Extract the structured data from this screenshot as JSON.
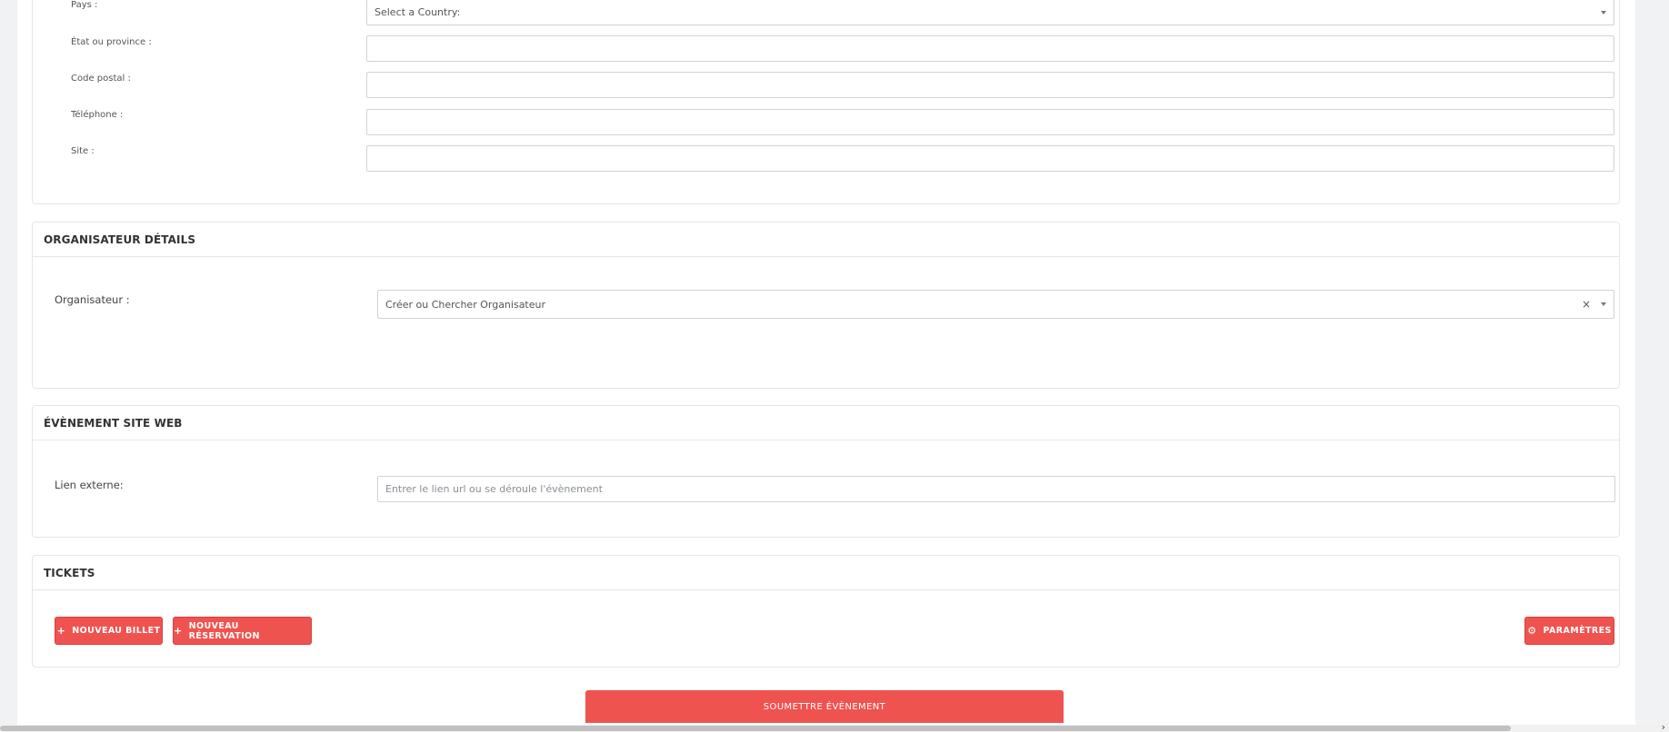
{
  "address_section": {
    "country_label": "Pays :",
    "country_value": "Select a Country:",
    "state_label": "État ou province :",
    "postal_label": "Code postal :",
    "phone_label": "Téléphone :",
    "site_label": "Site :"
  },
  "organizer_section": {
    "title": "ORGANISATEUR DÉTAILS",
    "organizer_label": "Organisateur :",
    "organizer_value": "Créer ou Chercher Organisateur",
    "clear_symbol": "×"
  },
  "website_section": {
    "title": "ÉVÈNEMENT SITE WEB",
    "link_label": "Lien externe:",
    "link_placeholder": "Entrer le lien url ou se déroule l'évènement"
  },
  "tickets_section": {
    "title": "TICKETS",
    "new_ticket_label": "NOUVEAU BILLET",
    "new_reservation_label": "NOUVEAU RÉSERVATION",
    "settings_label": "PARAMÈTRES"
  },
  "submit_label": "SOUMETTRE ÉVÈNEMENT",
  "icons": {
    "plus": "plus-icon",
    "gear": "gear-icon",
    "chevron": "chevron-down-icon",
    "scroll_right": "chevron-right-icon"
  },
  "colors": {
    "accent": "#ef5350",
    "border": "#e3e6ea",
    "background": "#f1f2f3"
  }
}
